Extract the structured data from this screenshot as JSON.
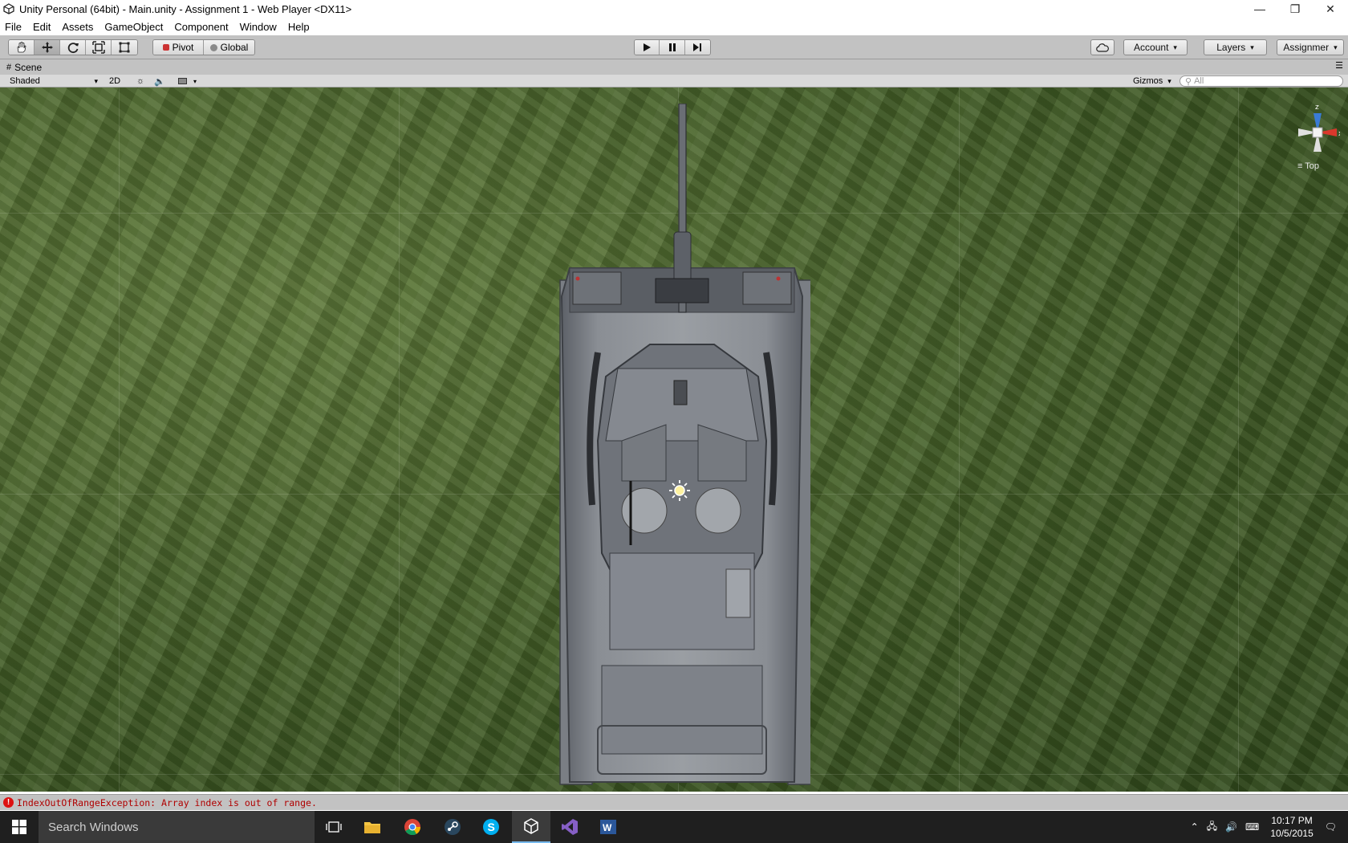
{
  "window": {
    "title": "Unity Personal (64bit) - Main.unity - Assignment 1 - Web Player <DX11>"
  },
  "menu": [
    "File",
    "Edit",
    "Assets",
    "GameObject",
    "Component",
    "Window",
    "Help"
  ],
  "toolbar": {
    "pivot_label": "Pivot",
    "global_label": "Global",
    "account_label": "Account",
    "layers_label": "Layers",
    "layout_label": "Assignmer"
  },
  "scene": {
    "tab_label": "Scene",
    "shading_mode": "Shaded",
    "mode_2d": "2D",
    "gizmos_label": "Gizmos",
    "search_placeholder": "All",
    "axis_z": "z",
    "axis_x": "x",
    "view_label": "Top"
  },
  "status": {
    "error_message": "IndexOutOfRangeException: Array index is out of range."
  },
  "taskbar": {
    "search_placeholder": "Search Windows",
    "time": "10:17 PM",
    "date": "10/5/2015"
  },
  "colors": {
    "error": "#b00000",
    "grass": "#3c5522",
    "taskbar": "#1f1f1f"
  }
}
